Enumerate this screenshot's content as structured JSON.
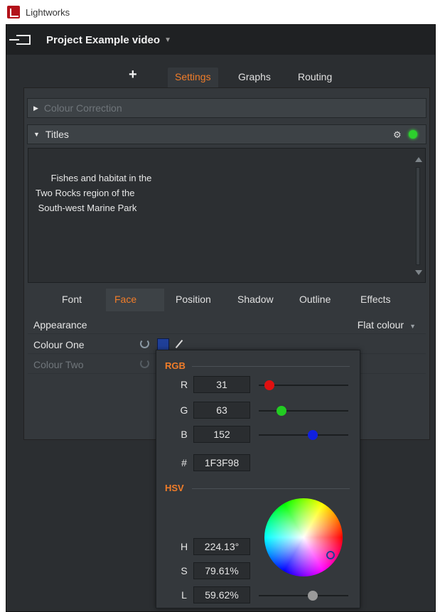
{
  "app": {
    "title": "Lightworks"
  },
  "project": {
    "title": "Project Example video"
  },
  "tabs": {
    "plus": "+",
    "settings": "Settings",
    "graphs": "Graphs",
    "routing": "Routing"
  },
  "sections": {
    "colour_correction": "Colour Correction",
    "titles": "Titles"
  },
  "title_text": "Fishes and habitat in the\nTwo Rocks region of the\n South-west Marine Park",
  "subtabs": [
    "Font",
    "Face",
    "Position",
    "Shadow",
    "Outline",
    "Effects"
  ],
  "properties": {
    "appearance_label": "Appearance",
    "appearance_value": "Flat colour",
    "colour_one": "Colour One",
    "colour_two": "Colour Two"
  },
  "picker": {
    "rgb_label": "RGB",
    "r_label": "R",
    "r": "31",
    "g_label": "G",
    "g": "63",
    "b_label": "B",
    "b": "152",
    "hex_label": "#",
    "hex": "1F3F98",
    "hsv_label": "HSV",
    "h_label": "H",
    "h": "224.13°",
    "s_label": "S",
    "s": "79.61%",
    "l_label": "L",
    "l": "59.62%",
    "r_level": 0.12,
    "g_level": 0.25,
    "b_level": 0.6,
    "l_level": 0.6
  },
  "colors": {
    "accent": "#f27d29",
    "swatch": "#1f3f98"
  }
}
